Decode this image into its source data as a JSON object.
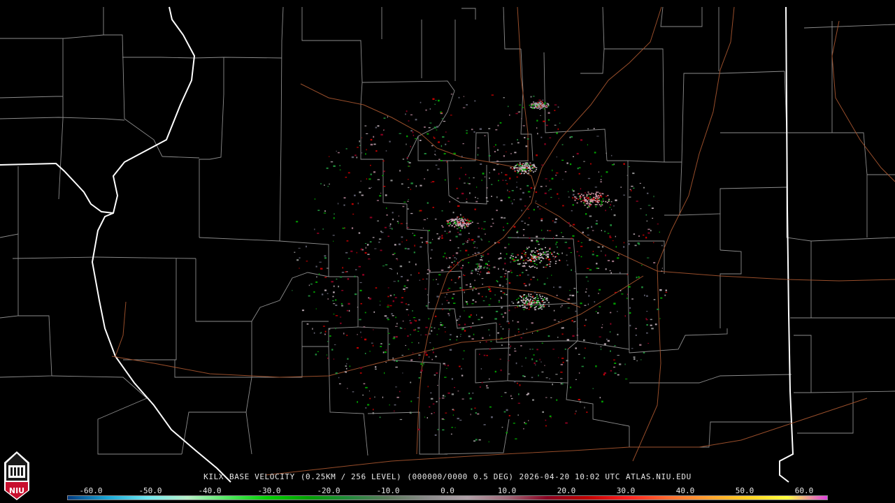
{
  "product": {
    "site": "KILX",
    "name": "BASE VELOCITY",
    "resolution": "(0.25KM / 256 LEVEL)",
    "volume": "(000000/0000",
    "elevation": "0.5 DEG)",
    "datetime": "2026-04-20 10:02 UTC",
    "source": "ATLAS.NIU.EDU"
  },
  "colorbar": {
    "ticks": [
      "-60.0",
      "-50.0",
      "-40.0",
      "-30.0",
      "-20.0",
      "-10.0",
      "0.0",
      "10.0",
      "20.0",
      "30.0",
      "40.0",
      "50.0",
      "60.0"
    ],
    "min": -64,
    "max": 64,
    "colors": [
      "#003a80",
      "#1aa8d8",
      "#6fe8f0",
      "#b8f0c8",
      "#50e860",
      "#00d000",
      "#00a000",
      "#208a3a",
      "#5a7a5a",
      "#8a8a8a",
      "#b0a0a8",
      "#a06878",
      "#8a0020",
      "#c00000",
      "#ff2020",
      "#ff6a30",
      "#ffa030",
      "#ffd020",
      "#ffff40",
      "#e040e0"
    ]
  },
  "logo": {
    "text": "NIU"
  },
  "map": {
    "background": "#000000",
    "county_line_color": "#9a9a9a",
    "state_line_color": "#ffffff",
    "highway_color": "#a0522d"
  }
}
